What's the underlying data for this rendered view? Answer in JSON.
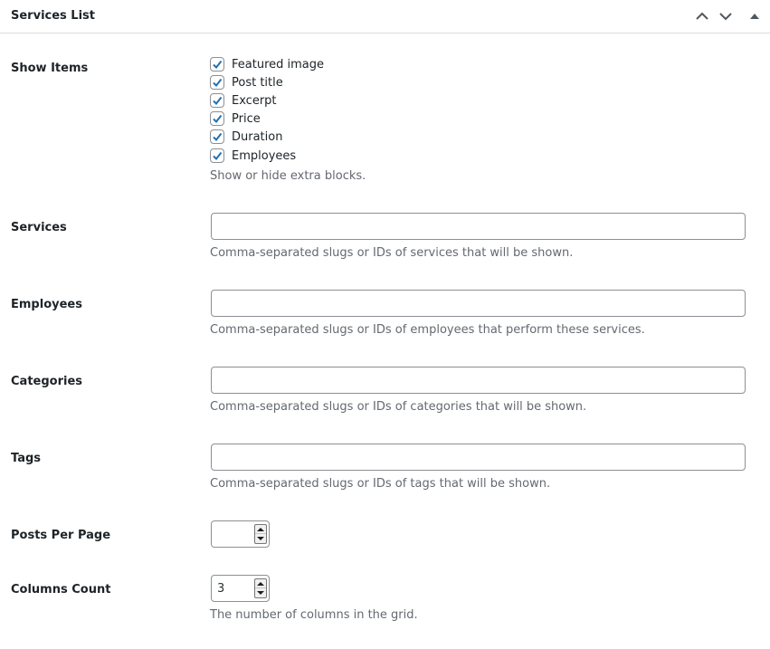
{
  "panel": {
    "title": "Services List",
    "controls": [
      "chevron-up-icon",
      "chevron-down-icon",
      "triangle-up-icon"
    ]
  },
  "show_items": {
    "label": "Show Items",
    "options": [
      {
        "label": "Featured image",
        "checked": true
      },
      {
        "label": "Post title",
        "checked": true
      },
      {
        "label": "Excerpt",
        "checked": true
      },
      {
        "label": "Price",
        "checked": true
      },
      {
        "label": "Duration",
        "checked": true
      },
      {
        "label": "Employees",
        "checked": true
      }
    ],
    "description": "Show or hide extra blocks."
  },
  "services": {
    "label": "Services",
    "value": "",
    "description": "Comma-separated slugs or IDs of services that will be shown."
  },
  "employees": {
    "label": "Employees",
    "value": "",
    "description": "Comma-separated slugs or IDs of employees that perform these services."
  },
  "categories": {
    "label": "Categories",
    "value": "",
    "description": "Comma-separated slugs or IDs of categories that will be shown."
  },
  "tags": {
    "label": "Tags",
    "value": "",
    "description": "Comma-separated slugs or IDs of tags that will be shown."
  },
  "posts_per_page": {
    "label": "Posts Per Page",
    "value": ""
  },
  "columns_count": {
    "label": "Columns Count",
    "value": "3",
    "description": "The number of columns in the grid."
  },
  "colors": {
    "checkmark": "#2271b1",
    "border": "#8c8f94",
    "description_text": "#646970",
    "divider": "#dcdcde"
  }
}
